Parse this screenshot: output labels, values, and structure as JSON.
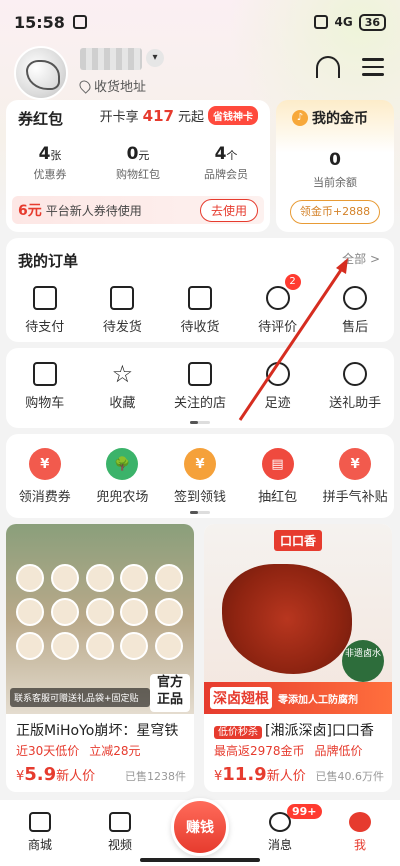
{
  "status_bar": {
    "time": "15:58",
    "battery": "36",
    "network": "4G"
  },
  "header": {
    "address_label": "收货地址"
  },
  "coupon": {
    "title": "券红包",
    "promo_prefix": "开卡享",
    "promo_amount": "417",
    "promo_suffix": "元起",
    "promo_tag": "省钱神卡",
    "stats": [
      {
        "value": "4",
        "unit": "张",
        "label": "优惠券"
      },
      {
        "value": "0",
        "unit": "元",
        "label": "购物红包"
      },
      {
        "value": "4",
        "unit": "个",
        "label": "品牌会员"
      }
    ],
    "newbie_amount": "6元",
    "newbie_text": "平台新人券待使用",
    "newbie_button": "去使用"
  },
  "coins": {
    "title": "我的金币",
    "value": "0",
    "label": "当前余额",
    "button": "领金币+2888"
  },
  "orders": {
    "title": "我的订单",
    "all_label": "全部 >",
    "items": [
      {
        "label": "待支付"
      },
      {
        "label": "待发货"
      },
      {
        "label": "待收货"
      },
      {
        "label": "待评价",
        "badge": "2"
      },
      {
        "label": "售后"
      }
    ]
  },
  "shortcuts": [
    {
      "label": "购物车"
    },
    {
      "label": "收藏"
    },
    {
      "label": "关注的店"
    },
    {
      "label": "足迹"
    },
    {
      "label": "送礼助手"
    }
  ],
  "activities": [
    {
      "label": "领消费券",
      "color": "#f25a4d",
      "glyph": "¥"
    },
    {
      "label": "兜兜农场",
      "color": "#3bb36a",
      "glyph": "🌳"
    },
    {
      "label": "签到领钱",
      "color": "#f5a13a",
      "glyph": "¥"
    },
    {
      "label": "抽红包",
      "color": "#ef4a3e",
      "glyph": "▤"
    },
    {
      "label": "拼手气补贴",
      "color": "#f25a4d",
      "glyph": "¥"
    }
  ],
  "products": [
    {
      "title": "正版MiHoYo崩坏：星穹铁",
      "flag": "",
      "sub1": "近30天低价",
      "sub2": "立减28元",
      "price_symbol": "¥",
      "price": "5.9",
      "price_note": "新人价",
      "sold": "已售1238件",
      "img_label": "联系客服可赠送礼品袋+固定贴",
      "img_badge": "官方\n正品"
    },
    {
      "title": "[湘派深卤]口口香",
      "flag": "低价秒杀",
      "sub1": "最高返2978金币",
      "sub2": "品牌低价",
      "price_symbol": "¥",
      "price": "11.9",
      "price_note": "新人价",
      "sold": "已售40.6万件",
      "img_logo": "口口香",
      "img_banner_big": "深卤翅根",
      "img_banner_small": "零添加人工防腐剂",
      "img_tag": "非遗卤水"
    }
  ],
  "tabbar": [
    {
      "label": "商城"
    },
    {
      "label": "视频"
    },
    {
      "label": "赚钱"
    },
    {
      "label": "消息",
      "badge": "99+"
    },
    {
      "label": "我"
    }
  ]
}
